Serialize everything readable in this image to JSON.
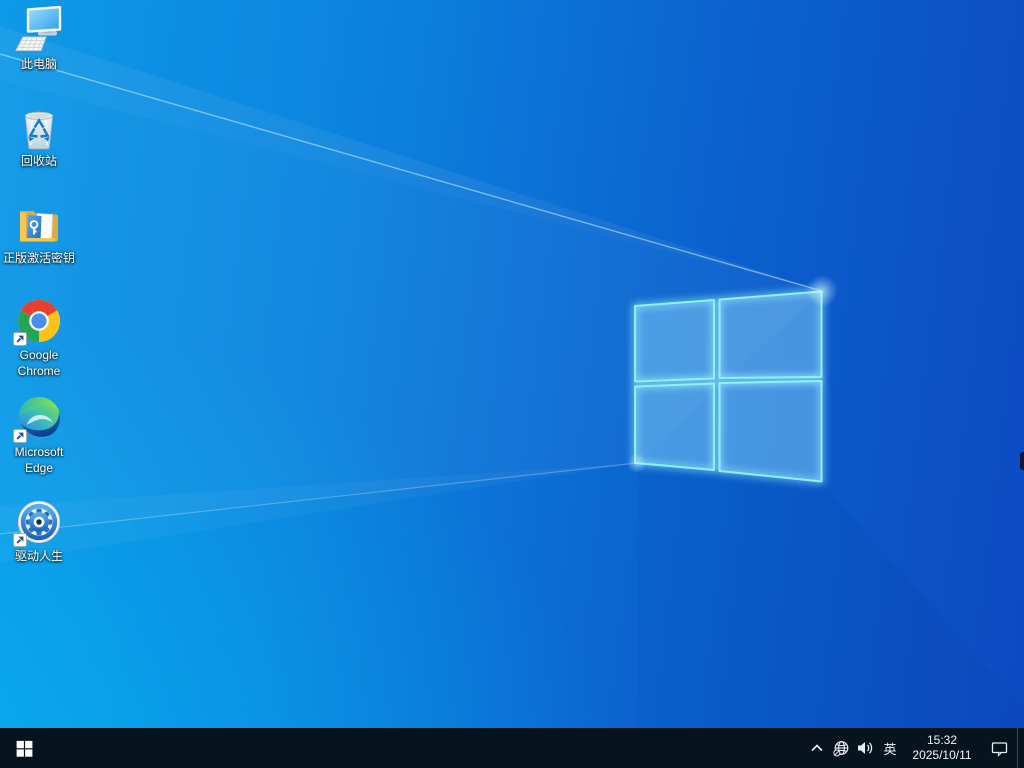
{
  "desktop": {
    "icons": [
      {
        "label": "此电脑",
        "icon": "computer-monitor-icon",
        "shortcut": false
      },
      {
        "label": "回收站",
        "icon": "recycle-bin-icon",
        "shortcut": false
      },
      {
        "label": "正版激活密钥",
        "icon": "folder-key-document-icon",
        "shortcut": false
      },
      {
        "label": "Google Chrome",
        "icon": "chrome-icon",
        "shortcut": true
      },
      {
        "label": "Microsoft Edge",
        "icon": "edge-icon",
        "shortcut": true
      },
      {
        "label": "驱动人生",
        "icon": "gear-driver-icon",
        "shortcut": true
      }
    ]
  },
  "wallpaper": {
    "motif": "windows-logo-light-rays",
    "colors": {
      "left": "#0d9ae8",
      "right": "#0c49c2",
      "logo_stroke": "#8df2ff"
    }
  },
  "taskbar": {
    "ime_label": "英",
    "clock": {
      "time": "15:32",
      "date": "2025/10/11"
    },
    "colors": {
      "background": "#06141e",
      "icon": "#e9eef2"
    }
  }
}
